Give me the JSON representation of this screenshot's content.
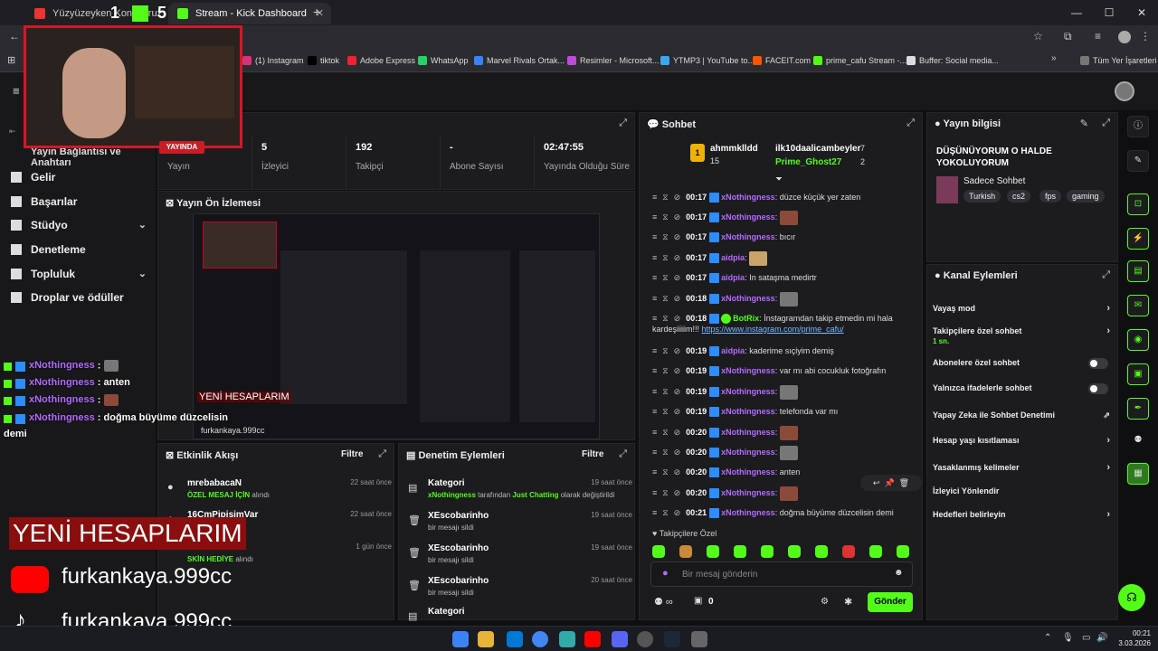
{
  "browser": {
    "tabs": [
      {
        "label": "Yüzyüzeyken Konuşuruz - Tu",
        "active": false
      },
      {
        "label": "Stream - Kick Dashboard",
        "active": true
      }
    ],
    "bookmarks": [
      "(1) Instagram",
      "tiktok",
      "Adobe Express",
      "WhatsApp",
      "Marvel Rivals Ortak...",
      "Resimler - Microsoft...",
      "YTMP3 | YouTube to...",
      "FACEIT.com",
      "prime_cafu Stream -...",
      "Buffer: Social media..."
    ],
    "all_bookmarks": "Tüm Yer İşaretleri"
  },
  "sidebar": {
    "partial_item": "Yayın Bağlantısı ve Anahtarı",
    "items": [
      {
        "label": "Gelir",
        "chev": false
      },
      {
        "label": "Başarılar",
        "chev": false
      },
      {
        "label": "Stüdyo",
        "chev": true
      },
      {
        "label": "Denetleme",
        "chev": false
      },
      {
        "label": "Topluluk",
        "chev": true
      },
      {
        "label": "Droplar ve ödüller",
        "chev": false
      }
    ]
  },
  "stats": {
    "live_badge": "YAYINDA",
    "live_label": "Yayın",
    "viewers": {
      "value": "5",
      "label": "İzleyici"
    },
    "followers": {
      "value": "192",
      "label": "Takipçi"
    },
    "subs": {
      "value": "-",
      "label": "Abone Sayısı"
    },
    "duration": {
      "value": "02:47:55",
      "label": "Yayında Olduğu Süre"
    }
  },
  "preview": {
    "title": "Yayın Ön İzlemesi",
    "overlay": "YENİ HESAPLARIM",
    "handle": "furkankaya.999cc"
  },
  "activity": {
    "title": "Etkinlik Akışı",
    "filter": "Filtre",
    "rows": [
      {
        "name": "mrebabacaN",
        "detail_hl": "ÖZEL MESAJ İÇİN",
        "detail": " alındı",
        "time": "22 saat önce"
      },
      {
        "name": "16CmPipisimVar",
        "detail_hl": "",
        "detail": "",
        "time": "22 saat önce"
      },
      {
        "name": "",
        "detail_hl": "SKİN HEDİYE",
        "detail": " alındı",
        "time": "1 gün önce"
      }
    ]
  },
  "moderation": {
    "title": "Denetim Eylemleri",
    "filter": "Filtre",
    "rows": [
      {
        "title": "Kategori",
        "user": "xNothingness",
        "mid": " tarafından ",
        "hl": "Just Chatting",
        "end": " olarak değiştirildi",
        "time": "19 saat önce"
      },
      {
        "title": "XEscobarinho",
        "user": "",
        "mid": "bir mesajı sildi",
        "hl": "",
        "end": "",
        "time": "19 saat önce"
      },
      {
        "title": "XEscobarinho",
        "user": "",
        "mid": "bir mesajı sildi",
        "hl": "",
        "end": "",
        "time": "19 saat önce"
      },
      {
        "title": "XEscobarinho",
        "user": "",
        "mid": "bir mesajı sildi",
        "hl": "",
        "end": "",
        "time": "20 saat önce"
      },
      {
        "title": "Kategori",
        "user": "",
        "mid": "",
        "hl": "",
        "end": "",
        "time": ""
      }
    ]
  },
  "chat": {
    "title": "Sohbet",
    "top": [
      {
        "name": "ahmmklldd",
        "count": "15"
      },
      {
        "name": "ilk10daalicambeyler",
        "count": "7"
      },
      {
        "name": "Prime_Ghost27",
        "count": "2"
      }
    ],
    "messages": [
      {
        "time": "00:17",
        "user": "xNothingness",
        "text": "düzce küçük yer zaten",
        "emote": ""
      },
      {
        "time": "00:17",
        "user": "xNothingness",
        "text": "",
        "emote": "face"
      },
      {
        "time": "00:17",
        "user": "xNothingness",
        "text": "bıcır",
        "emote": ""
      },
      {
        "time": "00:17",
        "user": "aidpia",
        "text": "",
        "emote": "dog"
      },
      {
        "time": "00:17",
        "user": "aidpia",
        "text": "In sataşma medirtr",
        "emote": ""
      },
      {
        "time": "00:18",
        "user": "xNothingness",
        "text": "",
        "emote": "cat"
      },
      {
        "time": "00:18",
        "user": "BotRix",
        "text": "İnstagramdan takip etmedin mi hala",
        "emote": ""
      },
      {
        "time": "00:19",
        "user": "aidpia",
        "text": "kaderime sıçiyim demiş",
        "emote": ""
      },
      {
        "time": "00:19",
        "user": "xNothingness",
        "text": "var mı abi cocukluk fotoğrafın",
        "emote": ""
      },
      {
        "time": "00:19",
        "user": "xNothingness",
        "text": "",
        "emote": "cat"
      },
      {
        "time": "00:19",
        "user": "xNothingness",
        "text": "telefonda var mı",
        "emote": ""
      },
      {
        "time": "00:20",
        "user": "xNothingness",
        "text": "",
        "emote": "face"
      },
      {
        "time": "00:20",
        "user": "xNothingness",
        "text": "",
        "emote": "cat"
      },
      {
        "time": "00:20",
        "user": "xNothingness",
        "text": "anten",
        "emote": ""
      },
      {
        "time": "00:20",
        "user": "xNothingness",
        "text": "",
        "emote": "face"
      },
      {
        "time": "00:21",
        "user": "xNothingness",
        "text": "doğma büyüme düzcelisin demi",
        "emote": ""
      }
    ],
    "botrix_cont": "kardeşiiiiim!!!",
    "botrix_link": "https://www.instagram.com/prime_cafu/",
    "followers_only": "Takipçilere Özel",
    "input_placeholder": "Bir mesaj gönderin",
    "points": "0",
    "send": "Gönder"
  },
  "stream_info": {
    "title": "Yayın bilgisi",
    "stream_title": "DÜŞÜNÜYORUM O HALDE YOKOLUYORUM",
    "category": "Sadece Sohbet",
    "tags": [
      "Turkish",
      "cs2",
      "fps",
      "gaming"
    ]
  },
  "channel_actions": {
    "title": "Kanal Eylemleri",
    "rows": [
      {
        "label": "Vayaş mod",
        "type": "arrow",
        "sub": ""
      },
      {
        "label": "Takipçilere özel sohbet",
        "type": "arrow",
        "sub": "1 sn."
      },
      {
        "label": "Abonelere özel sohbet",
        "type": "toggle",
        "sub": ""
      },
      {
        "label": "Yalnızca ifadelerle sohbet",
        "type": "toggle",
        "sub": ""
      },
      {
        "label": "Yapay Zeka ile Sohbet Denetimi",
        "type": "ext",
        "sub": ""
      },
      {
        "label": "Hesap yaşı kısıtlaması",
        "type": "arrow",
        "sub": ""
      },
      {
        "label": "Yasaklanmış kelimeler",
        "type": "arrow",
        "sub": ""
      },
      {
        "label": "İzleyici Yönlendir",
        "type": "none",
        "sub": ""
      },
      {
        "label": "Hedefleri belirleyin",
        "type": "arrow",
        "sub": ""
      }
    ]
  },
  "overlay": {
    "webcam_numbers": [
      "1",
      "5"
    ],
    "chat": [
      {
        "user": "xNothingness",
        "text": " : ",
        "emote": "cat"
      },
      {
        "user": "xNothingness",
        "text": " : anten",
        "emote": ""
      },
      {
        "user": "xNothingness",
        "text": " : ",
        "emote": "face"
      },
      {
        "user": "xNothingness",
        "text": " : doğma büyüme düzcelisin",
        "emote": ""
      }
    ],
    "chat_wrap": "demi",
    "banner": "YENİ HESAPLARIM",
    "youtube": "furkankaya.999cc",
    "tiktok": "furkankaya.999cc"
  },
  "taskbar": {
    "time": "00:21",
    "date": "3.03.2026"
  },
  "colors": {
    "accent": "#53fc18",
    "username": "#b36bff",
    "bg": "#0f0f11"
  }
}
